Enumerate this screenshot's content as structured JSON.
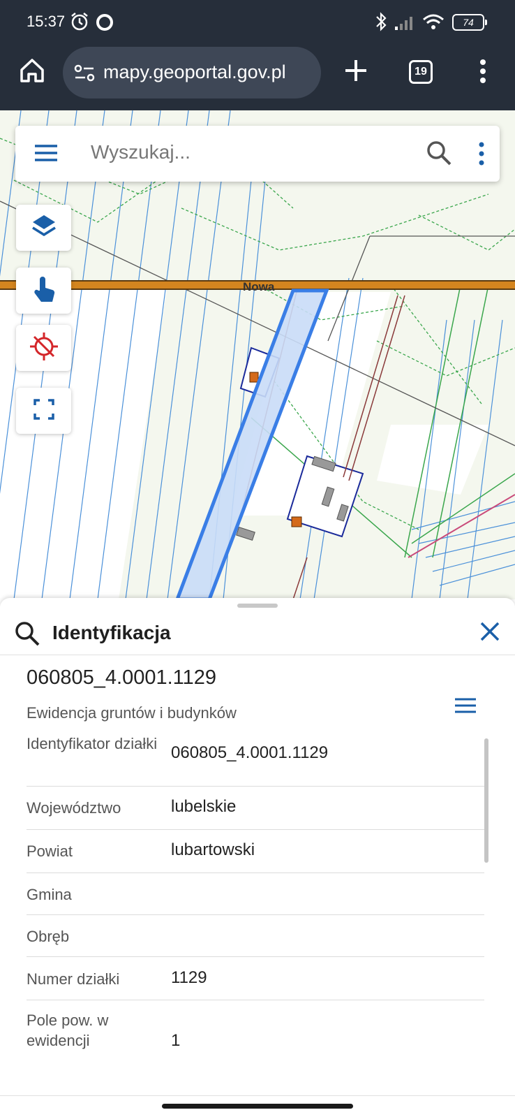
{
  "status_bar": {
    "time": "15:37",
    "battery": "74"
  },
  "browser": {
    "url": "mapy.geoportal.gov.pl",
    "tab_count": "19"
  },
  "map": {
    "search_placeholder": "Wyszukaj...",
    "road_label": "Nowa",
    "buttons": [
      "layers-icon",
      "identify-touch-icon",
      "gps-off-icon",
      "fullscreen-icon"
    ]
  },
  "panel": {
    "title": "Identyfikacja",
    "parcel_id": "060805_4.0001.1129",
    "layer_name": "Ewidencja gruntów i budynków",
    "properties": [
      {
        "key": "Identyfikator działki",
        "value": "060805_4.0001.1129"
      },
      {
        "key": "Województwo",
        "value": "lubelskie"
      },
      {
        "key": "Powiat",
        "value": "lubartowski"
      },
      {
        "key": "Gmina",
        "value": ""
      },
      {
        "key": "Obręb",
        "value": ""
      },
      {
        "key": "Numer działki",
        "value": "1129"
      },
      {
        "key": "Pole pow. w ewidencji",
        "value": "1"
      }
    ]
  },
  "colors": {
    "accent": "#1a5fa8",
    "topbar": "#262e3a",
    "parcel_fill": "#c9dcf7",
    "parcel_stroke": "#3a7ee6",
    "road": "#d4851f"
  }
}
